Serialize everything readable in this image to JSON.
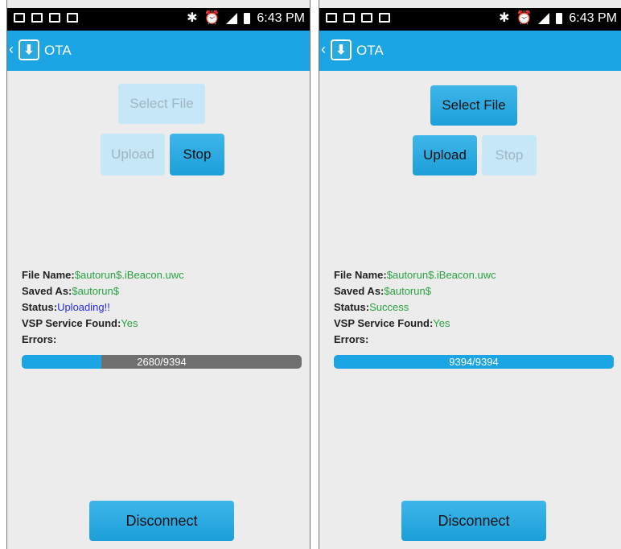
{
  "status_bar": {
    "time": "6:43 PM"
  },
  "screens": [
    {
      "title": "OTA",
      "select_file": {
        "label": "Select File",
        "enabled": false
      },
      "upload": {
        "label": "Upload",
        "enabled": false
      },
      "stop": {
        "label": "Stop",
        "enabled": true
      },
      "file_name": {
        "label": "File Name:",
        "value": "$autorun$.iBeacon.uwc"
      },
      "saved_as": {
        "label": "Saved As:",
        "value": "$autorun$"
      },
      "status": {
        "label": "Status:",
        "value": "Uploading!!"
      },
      "vsp": {
        "label": "VSP Service Found:",
        "value": "Yes"
      },
      "errors": {
        "label": "Errors:"
      },
      "progress": {
        "text": "2680/9394",
        "current": 2680,
        "total": 9394
      },
      "disconnect": {
        "label": "Disconnect"
      }
    },
    {
      "title": "OTA",
      "select_file": {
        "label": "Select File",
        "enabled": true
      },
      "upload": {
        "label": "Upload",
        "enabled": true
      },
      "stop": {
        "label": "Stop",
        "enabled": false
      },
      "file_name": {
        "label": "File Name:",
        "value": "$autorun$.iBeacon.uwc"
      },
      "saved_as": {
        "label": "Saved As:",
        "value": "$autorun$"
      },
      "status": {
        "label": "Status:",
        "value": "Success"
      },
      "vsp": {
        "label": "VSP Service Found:",
        "value": "Yes"
      },
      "errors": {
        "label": "Errors:"
      },
      "progress": {
        "text": "9394/9394",
        "current": 9394,
        "total": 9394
      },
      "disconnect": {
        "label": "Disconnect"
      }
    }
  ],
  "colors": {
    "accent": "#1ba5e4",
    "status_uploading": "#2a2af0",
    "status_success": "#2aa142"
  },
  "icons": [
    "email-icon",
    "image-icon",
    "voicemail-icon",
    "bluetooth-icon",
    "alarm-icon",
    "signal-icon",
    "battery-icon",
    "back-chevron-icon",
    "download-app-icon"
  ]
}
